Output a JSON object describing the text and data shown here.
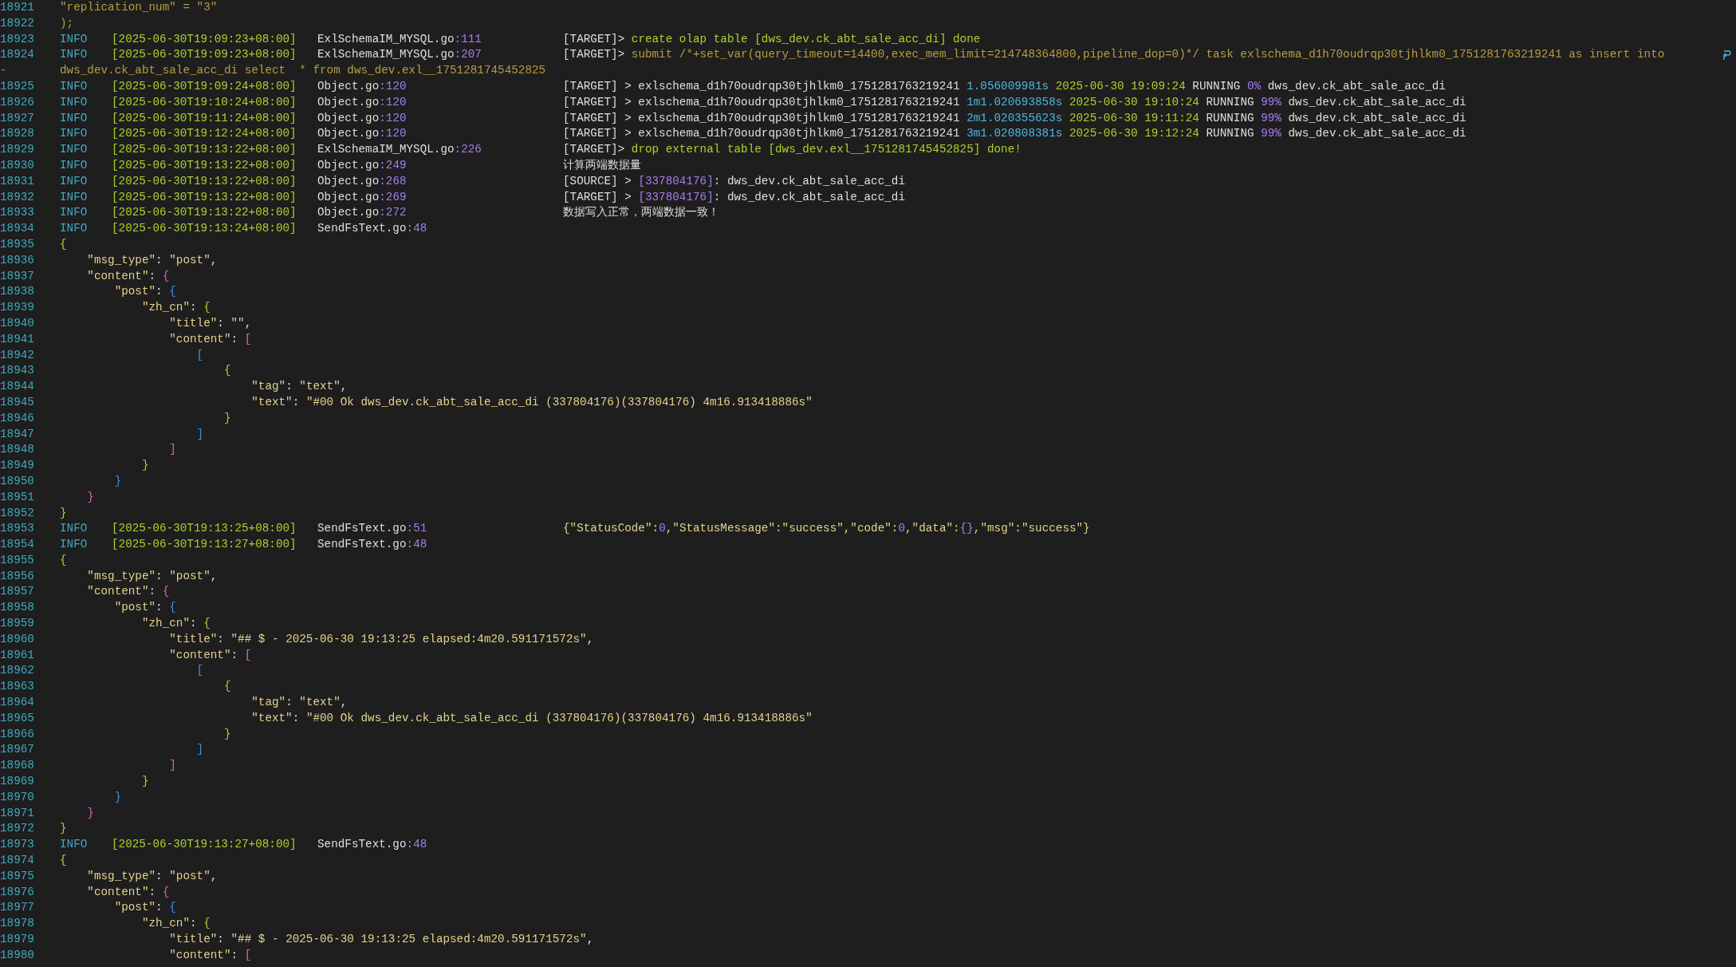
{
  "lines": [
    {
      "number": "18921",
      "kind": "code",
      "segments": [
        {
          "text": "\"replication_num\" = \"3\"",
          "kind": "olive"
        }
      ]
    },
    {
      "number": "18922",
      "kind": "code",
      "segments": [
        {
          "text": ");",
          "kind": "olive"
        }
      ]
    },
    {
      "number": "18923",
      "kind": "log",
      "level": "INFO",
      "timestamp": "[2025-06-30T19:09:23+08:00]",
      "wrapped": false,
      "source": [
        {
          "text": "ExlSchemaIM_MYSQL.go",
          "kind": "plain"
        },
        {
          "text": ":111",
          "kind": "number"
        }
      ],
      "message": [
        {
          "text": "[TARGET]> ",
          "kind": "plain"
        },
        {
          "text": "create olap table [dws_dev.ck_abt_sale_acc_di] done",
          "kind": "green"
        }
      ]
    },
    {
      "number": "18924",
      "kind": "log",
      "level": "INFO",
      "timestamp": "[2025-06-30T19:09:23+08:00]",
      "wrapped": true,
      "source": [
        {
          "text": "ExlSchemaIM_MYSQL.go",
          "kind": "plain"
        },
        {
          "text": ":207",
          "kind": "number"
        }
      ],
      "message": [
        {
          "text": "[TARGET]> ",
          "kind": "plain"
        },
        {
          "text": "submit /*+set_var(query_timeout=14400,exec_mem_limit=214748364800,pipeline_dop=0)*/ task exlschema_d1h70oudrqp30tjhlkm0_1751281763219241 as insert into",
          "kind": "olive"
        }
      ]
    },
    {
      "number": "-",
      "kind": "code",
      "segments": [
        {
          "text": "dws_dev.ck_abt_sale_acc_di select  * from dws_dev.exl__1751281745452825",
          "kind": "olive"
        }
      ]
    },
    {
      "number": "18925",
      "kind": "log",
      "level": "INFO",
      "timestamp": "[2025-06-30T19:09:24+08:00]",
      "wrapped": false,
      "source": [
        {
          "text": "Object.go",
          "kind": "plain"
        },
        {
          "text": ":120",
          "kind": "number"
        }
      ],
      "message": [
        {
          "text": "[TARGET] > exlschema_d1h70oudrqp30tjhlkm0_1751281763219241 ",
          "kind": "plain"
        },
        {
          "text": "1.056009981s",
          "kind": "cyan"
        },
        {
          "text": " 2025-06-30 19:09:24",
          "kind": "green"
        },
        {
          "text": " RUNNING ",
          "kind": "plain"
        },
        {
          "text": "0%",
          "kind": "number"
        },
        {
          "text": " dws_dev.ck_abt_sale_acc_di",
          "kind": "plain"
        }
      ]
    },
    {
      "number": "18926",
      "kind": "log",
      "level": "INFO",
      "timestamp": "[2025-06-30T19:10:24+08:00]",
      "wrapped": false,
      "source": [
        {
          "text": "Object.go",
          "kind": "plain"
        },
        {
          "text": ":120",
          "kind": "number"
        }
      ],
      "message": [
        {
          "text": "[TARGET] > exlschema_d1h70oudrqp30tjhlkm0_1751281763219241 ",
          "kind": "plain"
        },
        {
          "text": "1m1.020693858s",
          "kind": "cyan"
        },
        {
          "text": " 2025-06-30 19:10:24",
          "kind": "green"
        },
        {
          "text": " RUNNING ",
          "kind": "plain"
        },
        {
          "text": "99%",
          "kind": "number"
        },
        {
          "text": " dws_dev.ck_abt_sale_acc_di",
          "kind": "plain"
        }
      ]
    },
    {
      "number": "18927",
      "kind": "log",
      "level": "INFO",
      "timestamp": "[2025-06-30T19:11:24+08:00]",
      "wrapped": false,
      "source": [
        {
          "text": "Object.go",
          "kind": "plain"
        },
        {
          "text": ":120",
          "kind": "number"
        }
      ],
      "message": [
        {
          "text": "[TARGET] > exlschema_d1h70oudrqp30tjhlkm0_1751281763219241 ",
          "kind": "plain"
        },
        {
          "text": "2m1.020355623s",
          "kind": "cyan"
        },
        {
          "text": " 2025-06-30 19:11:24",
          "kind": "green"
        },
        {
          "text": " RUNNING ",
          "kind": "plain"
        },
        {
          "text": "99%",
          "kind": "number"
        },
        {
          "text": " dws_dev.ck_abt_sale_acc_di",
          "kind": "plain"
        }
      ]
    },
    {
      "number": "18928",
      "kind": "log",
      "level": "INFO",
      "timestamp": "[2025-06-30T19:12:24+08:00]",
      "wrapped": false,
      "source": [
        {
          "text": "Object.go",
          "kind": "plain"
        },
        {
          "text": ":120",
          "kind": "number"
        }
      ],
      "message": [
        {
          "text": "[TARGET] > exlschema_d1h70oudrqp30tjhlkm0_1751281763219241 ",
          "kind": "plain"
        },
        {
          "text": "3m1.020808381s",
          "kind": "cyan"
        },
        {
          "text": " 2025-06-30 19:12:24",
          "kind": "green"
        },
        {
          "text": " RUNNING ",
          "kind": "plain"
        },
        {
          "text": "99%",
          "kind": "number"
        },
        {
          "text": " dws_dev.ck_abt_sale_acc_di",
          "kind": "plain"
        }
      ]
    },
    {
      "number": "18929",
      "kind": "log",
      "level": "INFO",
      "timestamp": "[2025-06-30T19:13:22+08:00]",
      "wrapped": false,
      "source": [
        {
          "text": "ExlSchemaIM_MYSQL.go",
          "kind": "plain"
        },
        {
          "text": ":226",
          "kind": "number"
        }
      ],
      "message": [
        {
          "text": "[TARGET]> ",
          "kind": "plain"
        },
        {
          "text": "drop external table [dws_dev.exl__1751281745452825] done!",
          "kind": "green"
        }
      ]
    },
    {
      "number": "18930",
      "kind": "log",
      "level": "INFO",
      "timestamp": "[2025-06-30T19:13:22+08:00]",
      "wrapped": false,
      "source": [
        {
          "text": "Object.go",
          "kind": "plain"
        },
        {
          "text": ":249",
          "kind": "number"
        }
      ],
      "message": [
        {
          "text": "计算两端数据量",
          "kind": "plain"
        }
      ]
    },
    {
      "number": "18931",
      "kind": "log",
      "level": "INFO",
      "timestamp": "[2025-06-30T19:13:22+08:00]",
      "wrapped": false,
      "source": [
        {
          "text": "Object.go",
          "kind": "plain"
        },
        {
          "text": ":268",
          "kind": "number"
        }
      ],
      "message": [
        {
          "text": "[SOURCE] > ",
          "kind": "plain"
        },
        {
          "text": "[337804176]",
          "kind": "number"
        },
        {
          "text": ": dws_dev.ck_abt_sale_acc_di",
          "kind": "plain"
        }
      ]
    },
    {
      "number": "18932",
      "kind": "log",
      "level": "INFO",
      "timestamp": "[2025-06-30T19:13:22+08:00]",
      "wrapped": false,
      "source": [
        {
          "text": "Object.go",
          "kind": "plain"
        },
        {
          "text": ":269",
          "kind": "number"
        }
      ],
      "message": [
        {
          "text": "[TARGET] > ",
          "kind": "plain"
        },
        {
          "text": "[337804176]",
          "kind": "number"
        },
        {
          "text": ": dws_dev.ck_abt_sale_acc_di",
          "kind": "plain"
        }
      ]
    },
    {
      "number": "18933",
      "kind": "log",
      "level": "INFO",
      "timestamp": "[2025-06-30T19:13:22+08:00]",
      "wrapped": false,
      "source": [
        {
          "text": "Object.go",
          "kind": "plain"
        },
        {
          "text": ":272",
          "kind": "number"
        }
      ],
      "message": [
        {
          "text": "数据写入正常，两端数据一致！",
          "kind": "plain"
        }
      ]
    },
    {
      "number": "18934",
      "kind": "log",
      "level": "INFO",
      "timestamp": "[2025-06-30T19:13:24+08:00]",
      "wrapped": false,
      "source": [
        {
          "text": "SendFsText.go",
          "kind": "plain"
        },
        {
          "text": ":48",
          "kind": "number"
        }
      ]
    },
    {
      "number": "18935",
      "kind": "code",
      "segments": [
        {
          "text": "{",
          "kind": "brace-green"
        }
      ]
    },
    {
      "number": "18936",
      "kind": "code",
      "segments": [
        {
          "text": "    \"msg_type\"",
          "kind": "string"
        },
        {
          "text": ": ",
          "kind": "plain"
        },
        {
          "text": "\"post\"",
          "kind": "string"
        },
        {
          "text": ",",
          "kind": "plain"
        }
      ]
    },
    {
      "number": "18937",
      "kind": "code",
      "segments": [
        {
          "text": "    \"content\"",
          "kind": "string"
        },
        {
          "text": ": ",
          "kind": "plain"
        },
        {
          "text": "{",
          "kind": "brace-pink"
        }
      ]
    },
    {
      "number": "18938",
      "kind": "code",
      "segments": [
        {
          "text": "        \"post\"",
          "kind": "string"
        },
        {
          "text": ": ",
          "kind": "plain"
        },
        {
          "text": "{",
          "kind": "brace-blue"
        }
      ]
    },
    {
      "number": "18939",
      "kind": "code",
      "segments": [
        {
          "text": "            \"zh_cn\"",
          "kind": "string"
        },
        {
          "text": ": ",
          "kind": "plain"
        },
        {
          "text": "{",
          "kind": "brace-green"
        }
      ]
    },
    {
      "number": "18940",
      "kind": "code",
      "segments": [
        {
          "text": "                \"title\"",
          "kind": "string"
        },
        {
          "text": ": ",
          "kind": "plain"
        },
        {
          "text": "\"\"",
          "kind": "string"
        },
        {
          "text": ",",
          "kind": "plain"
        }
      ]
    },
    {
      "number": "18941",
      "kind": "code",
      "segments": [
        {
          "text": "                \"content\"",
          "kind": "string"
        },
        {
          "text": ": ",
          "kind": "plain"
        },
        {
          "text": "[",
          "kind": "brace-pink"
        }
      ]
    },
    {
      "number": "18942",
      "kind": "code",
      "segments": [
        {
          "text": "                    [",
          "kind": "brace-blue"
        }
      ]
    },
    {
      "number": "18943",
      "kind": "code",
      "segments": [
        {
          "text": "                        {",
          "kind": "brace-green"
        }
      ]
    },
    {
      "number": "18944",
      "kind": "code",
      "segments": [
        {
          "text": "                            \"tag\"",
          "kind": "string"
        },
        {
          "text": ": ",
          "kind": "plain"
        },
        {
          "text": "\"text\"",
          "kind": "string"
        },
        {
          "text": ",",
          "kind": "plain"
        }
      ]
    },
    {
      "number": "18945",
      "kind": "code",
      "segments": [
        {
          "text": "                            \"text\"",
          "kind": "string"
        },
        {
          "text": ": ",
          "kind": "plain"
        },
        {
          "text": "\"#00 Ok dws_dev.ck_abt_sale_acc_di (337804176)(337804176) 4m16.913418886s\"",
          "kind": "string"
        }
      ]
    },
    {
      "number": "18946",
      "kind": "code",
      "segments": [
        {
          "text": "                        }",
          "kind": "brace-green"
        }
      ]
    },
    {
      "number": "18947",
      "kind": "code",
      "segments": [
        {
          "text": "                    ]",
          "kind": "brace-blue"
        }
      ]
    },
    {
      "number": "18948",
      "kind": "code",
      "segments": [
        {
          "text": "                ]",
          "kind": "brace-pink"
        }
      ]
    },
    {
      "number": "18949",
      "kind": "code",
      "segments": [
        {
          "text": "            }",
          "kind": "brace-green"
        }
      ]
    },
    {
      "number": "18950",
      "kind": "code",
      "segments": [
        {
          "text": "        }",
          "kind": "brace-blue"
        }
      ]
    },
    {
      "number": "18951",
      "kind": "code",
      "segments": [
        {
          "text": "    }",
          "kind": "brace-pink"
        }
      ]
    },
    {
      "number": "18952",
      "kind": "code",
      "segments": [
        {
          "text": "}",
          "kind": "brace-green"
        }
      ]
    },
    {
      "number": "18953",
      "kind": "log",
      "level": "INFO",
      "timestamp": "[2025-06-30T19:13:25+08:00]",
      "wrapped": false,
      "source": [
        {
          "text": "SendFsText.go",
          "kind": "plain"
        },
        {
          "text": ":51",
          "kind": "number"
        }
      ],
      "message": [
        {
          "text": "{\"StatusCode\":",
          "kind": "string"
        },
        {
          "text": "0",
          "kind": "number"
        },
        {
          "text": ",\"StatusMessage\":\"success\",\"code\":",
          "kind": "string"
        },
        {
          "text": "0",
          "kind": "number"
        },
        {
          "text": ",\"data\":",
          "kind": "string"
        },
        {
          "text": "{}",
          "kind": "number"
        },
        {
          "text": ",\"msg\":\"success\"}",
          "kind": "string"
        }
      ]
    },
    {
      "number": "18954",
      "kind": "log",
      "level": "INFO",
      "timestamp": "[2025-06-30T19:13:27+08:00]",
      "wrapped": false,
      "source": [
        {
          "text": "SendFsText.go",
          "kind": "plain"
        },
        {
          "text": ":48",
          "kind": "number"
        }
      ]
    },
    {
      "number": "18955",
      "kind": "code",
      "segments": [
        {
          "text": "{",
          "kind": "brace-green"
        }
      ]
    },
    {
      "number": "18956",
      "kind": "code",
      "segments": [
        {
          "text": "    \"msg_type\"",
          "kind": "string"
        },
        {
          "text": ": ",
          "kind": "plain"
        },
        {
          "text": "\"post\"",
          "kind": "string"
        },
        {
          "text": ",",
          "kind": "plain"
        }
      ]
    },
    {
      "number": "18957",
      "kind": "code",
      "segments": [
        {
          "text": "    \"content\"",
          "kind": "string"
        },
        {
          "text": ": ",
          "kind": "plain"
        },
        {
          "text": "{",
          "kind": "brace-pink"
        }
      ]
    },
    {
      "number": "18958",
      "kind": "code",
      "segments": [
        {
          "text": "        \"post\"",
          "kind": "string"
        },
        {
          "text": ": ",
          "kind": "plain"
        },
        {
          "text": "{",
          "kind": "brace-blue"
        }
      ]
    },
    {
      "number": "18959",
      "kind": "code",
      "segments": [
        {
          "text": "            \"zh_cn\"",
          "kind": "string"
        },
        {
          "text": ": ",
          "kind": "plain"
        },
        {
          "text": "{",
          "kind": "brace-green"
        }
      ]
    },
    {
      "number": "18960",
      "kind": "code",
      "segments": [
        {
          "text": "                \"title\"",
          "kind": "string"
        },
        {
          "text": ": ",
          "kind": "plain"
        },
        {
          "text": "\"## $ - 2025-06-30 19:13:25 elapsed:4m20.591171572s\"",
          "kind": "string"
        },
        {
          "text": ",",
          "kind": "plain"
        }
      ]
    },
    {
      "number": "18961",
      "kind": "code",
      "segments": [
        {
          "text": "                \"content\"",
          "kind": "string"
        },
        {
          "text": ": ",
          "kind": "plain"
        },
        {
          "text": "[",
          "kind": "brace-pink"
        }
      ]
    },
    {
      "number": "18962",
      "kind": "code",
      "segments": [
        {
          "text": "                    [",
          "kind": "brace-blue"
        }
      ]
    },
    {
      "number": "18963",
      "kind": "code",
      "segments": [
        {
          "text": "                        {",
          "kind": "brace-green"
        }
      ]
    },
    {
      "number": "18964",
      "kind": "code",
      "segments": [
        {
          "text": "                            \"tag\"",
          "kind": "string"
        },
        {
          "text": ": ",
          "kind": "plain"
        },
        {
          "text": "\"text\"",
          "kind": "string"
        },
        {
          "text": ",",
          "kind": "plain"
        }
      ]
    },
    {
      "number": "18965",
      "kind": "code",
      "segments": [
        {
          "text": "                            \"text\"",
          "kind": "string"
        },
        {
          "text": ": ",
          "kind": "plain"
        },
        {
          "text": "\"#00 Ok dws_dev.ck_abt_sale_acc_di (337804176)(337804176) 4m16.913418886s\"",
          "kind": "string"
        }
      ]
    },
    {
      "number": "18966",
      "kind": "code",
      "segments": [
        {
          "text": "                        }",
          "kind": "brace-green"
        }
      ]
    },
    {
      "number": "18967",
      "kind": "code",
      "segments": [
        {
          "text": "                    ]",
          "kind": "brace-blue"
        }
      ]
    },
    {
      "number": "18968",
      "kind": "code",
      "segments": [
        {
          "text": "                ]",
          "kind": "brace-pink"
        }
      ]
    },
    {
      "number": "18969",
      "kind": "code",
      "segments": [
        {
          "text": "            }",
          "kind": "brace-green"
        }
      ]
    },
    {
      "number": "18970",
      "kind": "code",
      "segments": [
        {
          "text": "        }",
          "kind": "brace-blue"
        }
      ]
    },
    {
      "number": "18971",
      "kind": "code",
      "segments": [
        {
          "text": "    }",
          "kind": "brace-pink"
        }
      ]
    },
    {
      "number": "18972",
      "kind": "code",
      "segments": [
        {
          "text": "}",
          "kind": "brace-green"
        }
      ]
    },
    {
      "number": "18973",
      "kind": "log",
      "level": "INFO",
      "timestamp": "[2025-06-30T19:13:27+08:00]",
      "wrapped": false,
      "source": [
        {
          "text": "SendFsText.go",
          "kind": "plain"
        },
        {
          "text": ":48",
          "kind": "number"
        }
      ]
    },
    {
      "number": "18974",
      "kind": "code",
      "segments": [
        {
          "text": "{",
          "kind": "brace-green"
        }
      ]
    },
    {
      "number": "18975",
      "kind": "code",
      "segments": [
        {
          "text": "    \"msg_type\"",
          "kind": "string"
        },
        {
          "text": ": ",
          "kind": "plain"
        },
        {
          "text": "\"post\"",
          "kind": "string"
        },
        {
          "text": ",",
          "kind": "plain"
        }
      ]
    },
    {
      "number": "18976",
      "kind": "code",
      "segments": [
        {
          "text": "    \"content\"",
          "kind": "string"
        },
        {
          "text": ": ",
          "kind": "plain"
        },
        {
          "text": "{",
          "kind": "brace-pink"
        }
      ]
    },
    {
      "number": "18977",
      "kind": "code",
      "segments": [
        {
          "text": "        \"post\"",
          "kind": "string"
        },
        {
          "text": ": ",
          "kind": "plain"
        },
        {
          "text": "{",
          "kind": "brace-blue"
        }
      ]
    },
    {
      "number": "18978",
      "kind": "code",
      "segments": [
        {
          "text": "            \"zh_cn\"",
          "kind": "string"
        },
        {
          "text": ": ",
          "kind": "plain"
        },
        {
          "text": "{",
          "kind": "brace-green"
        }
      ]
    },
    {
      "number": "18979",
      "kind": "code",
      "segments": [
        {
          "text": "                \"title\"",
          "kind": "string"
        },
        {
          "text": ": ",
          "kind": "plain"
        },
        {
          "text": "\"## $ - 2025-06-30 19:13:25 elapsed:4m20.591171572s\"",
          "kind": "string"
        },
        {
          "text": ",",
          "kind": "plain"
        }
      ]
    },
    {
      "number": "18980",
      "kind": "code",
      "segments": [
        {
          "text": "                \"content\"",
          "kind": "string"
        },
        {
          "text": ": ",
          "kind": "plain"
        },
        {
          "text": "[",
          "kind": "brace-pink"
        }
      ]
    }
  ]
}
